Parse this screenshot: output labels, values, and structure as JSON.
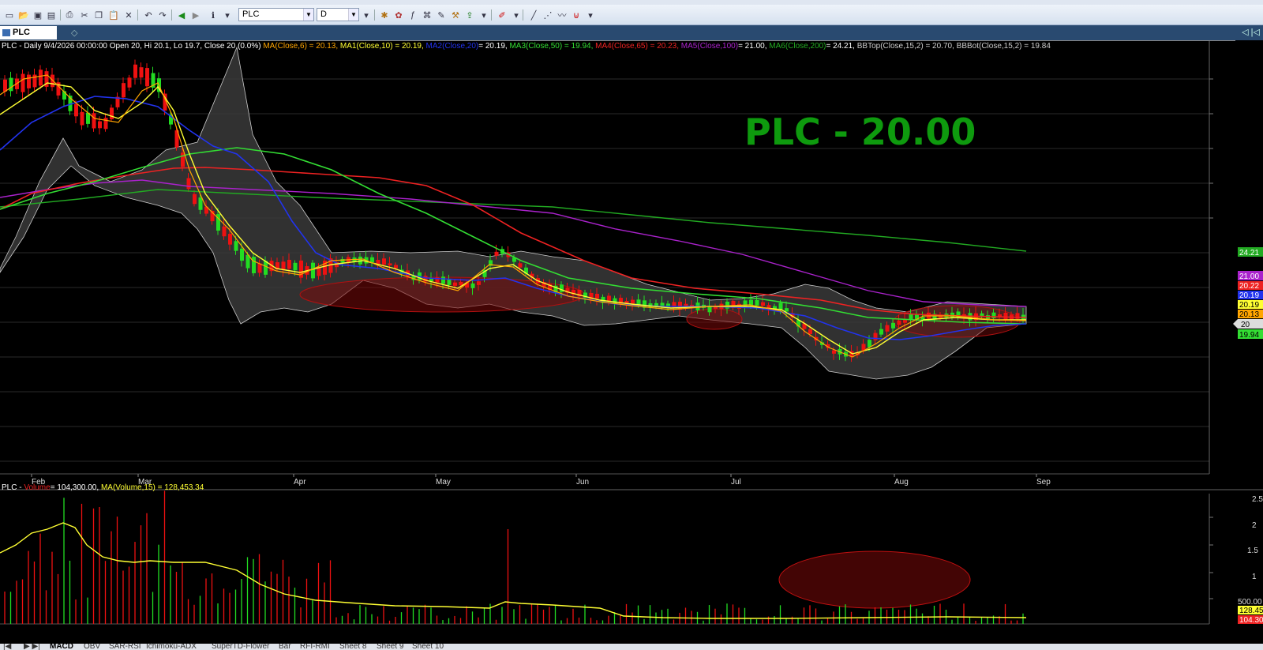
{
  "toolbar": {
    "symbol_value": "PLC",
    "interval_value": "D"
  },
  "chart_tab": {
    "label": "PLC (Daily)"
  },
  "price_panel": {
    "legend": {
      "prefix": "PLC - Daily 9/4/2026 00:00:00 Open 20, Hi 20.1, Lo 19.7, Close 20 (0.0%)",
      "ma": "MA(Close,6) = 20.13,",
      "ma1": "MA1(Close,10) = 20.19,",
      "ma2_name": "MA2(Close,20)",
      "ma2_val": "= 20.19,",
      "ma3": "MA3(Close,50) = 19.94,",
      "ma4": "MA4(Close,65) = 20.23,",
      "ma5_name": "MA5(Close,100)",
      "ma5_val": "= 21.00,",
      "ma6_name": "MA6(Close,200)",
      "ma6_val": "= 24.21,",
      "bbtop": "BBTop(Close,15,2) = 20.70,",
      "bbbot": "BBBot(Close,15,2) = 19.84"
    },
    "watermark": "PLC - 20.00",
    "price_tags": [
      "24.21",
      "21.00",
      "20.22",
      "20.19",
      "20.19",
      "20.13",
      "20",
      "19.94"
    ],
    "x_labels": [
      "Feb",
      "Mar",
      "Apr",
      "May",
      "Jun",
      "Jul",
      "Aug",
      "Sep"
    ]
  },
  "volume_panel": {
    "legend": {
      "prefix": "PLC -",
      "volume": "Volume",
      "volume_val": "= 104,300.00,",
      "ma": "MA(Volume,15) = 128,453.34"
    },
    "y_labels": [
      "2.5",
      "2",
      "1.5",
      "1",
      "500.00"
    ],
    "tags": [
      "128.45",
      "104.30"
    ]
  },
  "sheet_tabs": [
    "MACD",
    "OBV",
    "SAR-RSI",
    "Ichimoku-ADX",
    "SuperTD-Flower",
    "Bar",
    "RFI-RMI",
    "Sheet 8",
    "Sheet 9",
    "Sheet 10"
  ],
  "colors": {
    "up": "#22dd22",
    "down": "#ee1111",
    "ma": "#ffa500",
    "ma1": "#ffff33",
    "ma2": "#2233ee",
    "ma3": "#33dd33",
    "ma4": "#ee2222",
    "ma5": "#aa22cc",
    "ma6": "#22aa22",
    "watermark": "#0e9a0e"
  }
}
